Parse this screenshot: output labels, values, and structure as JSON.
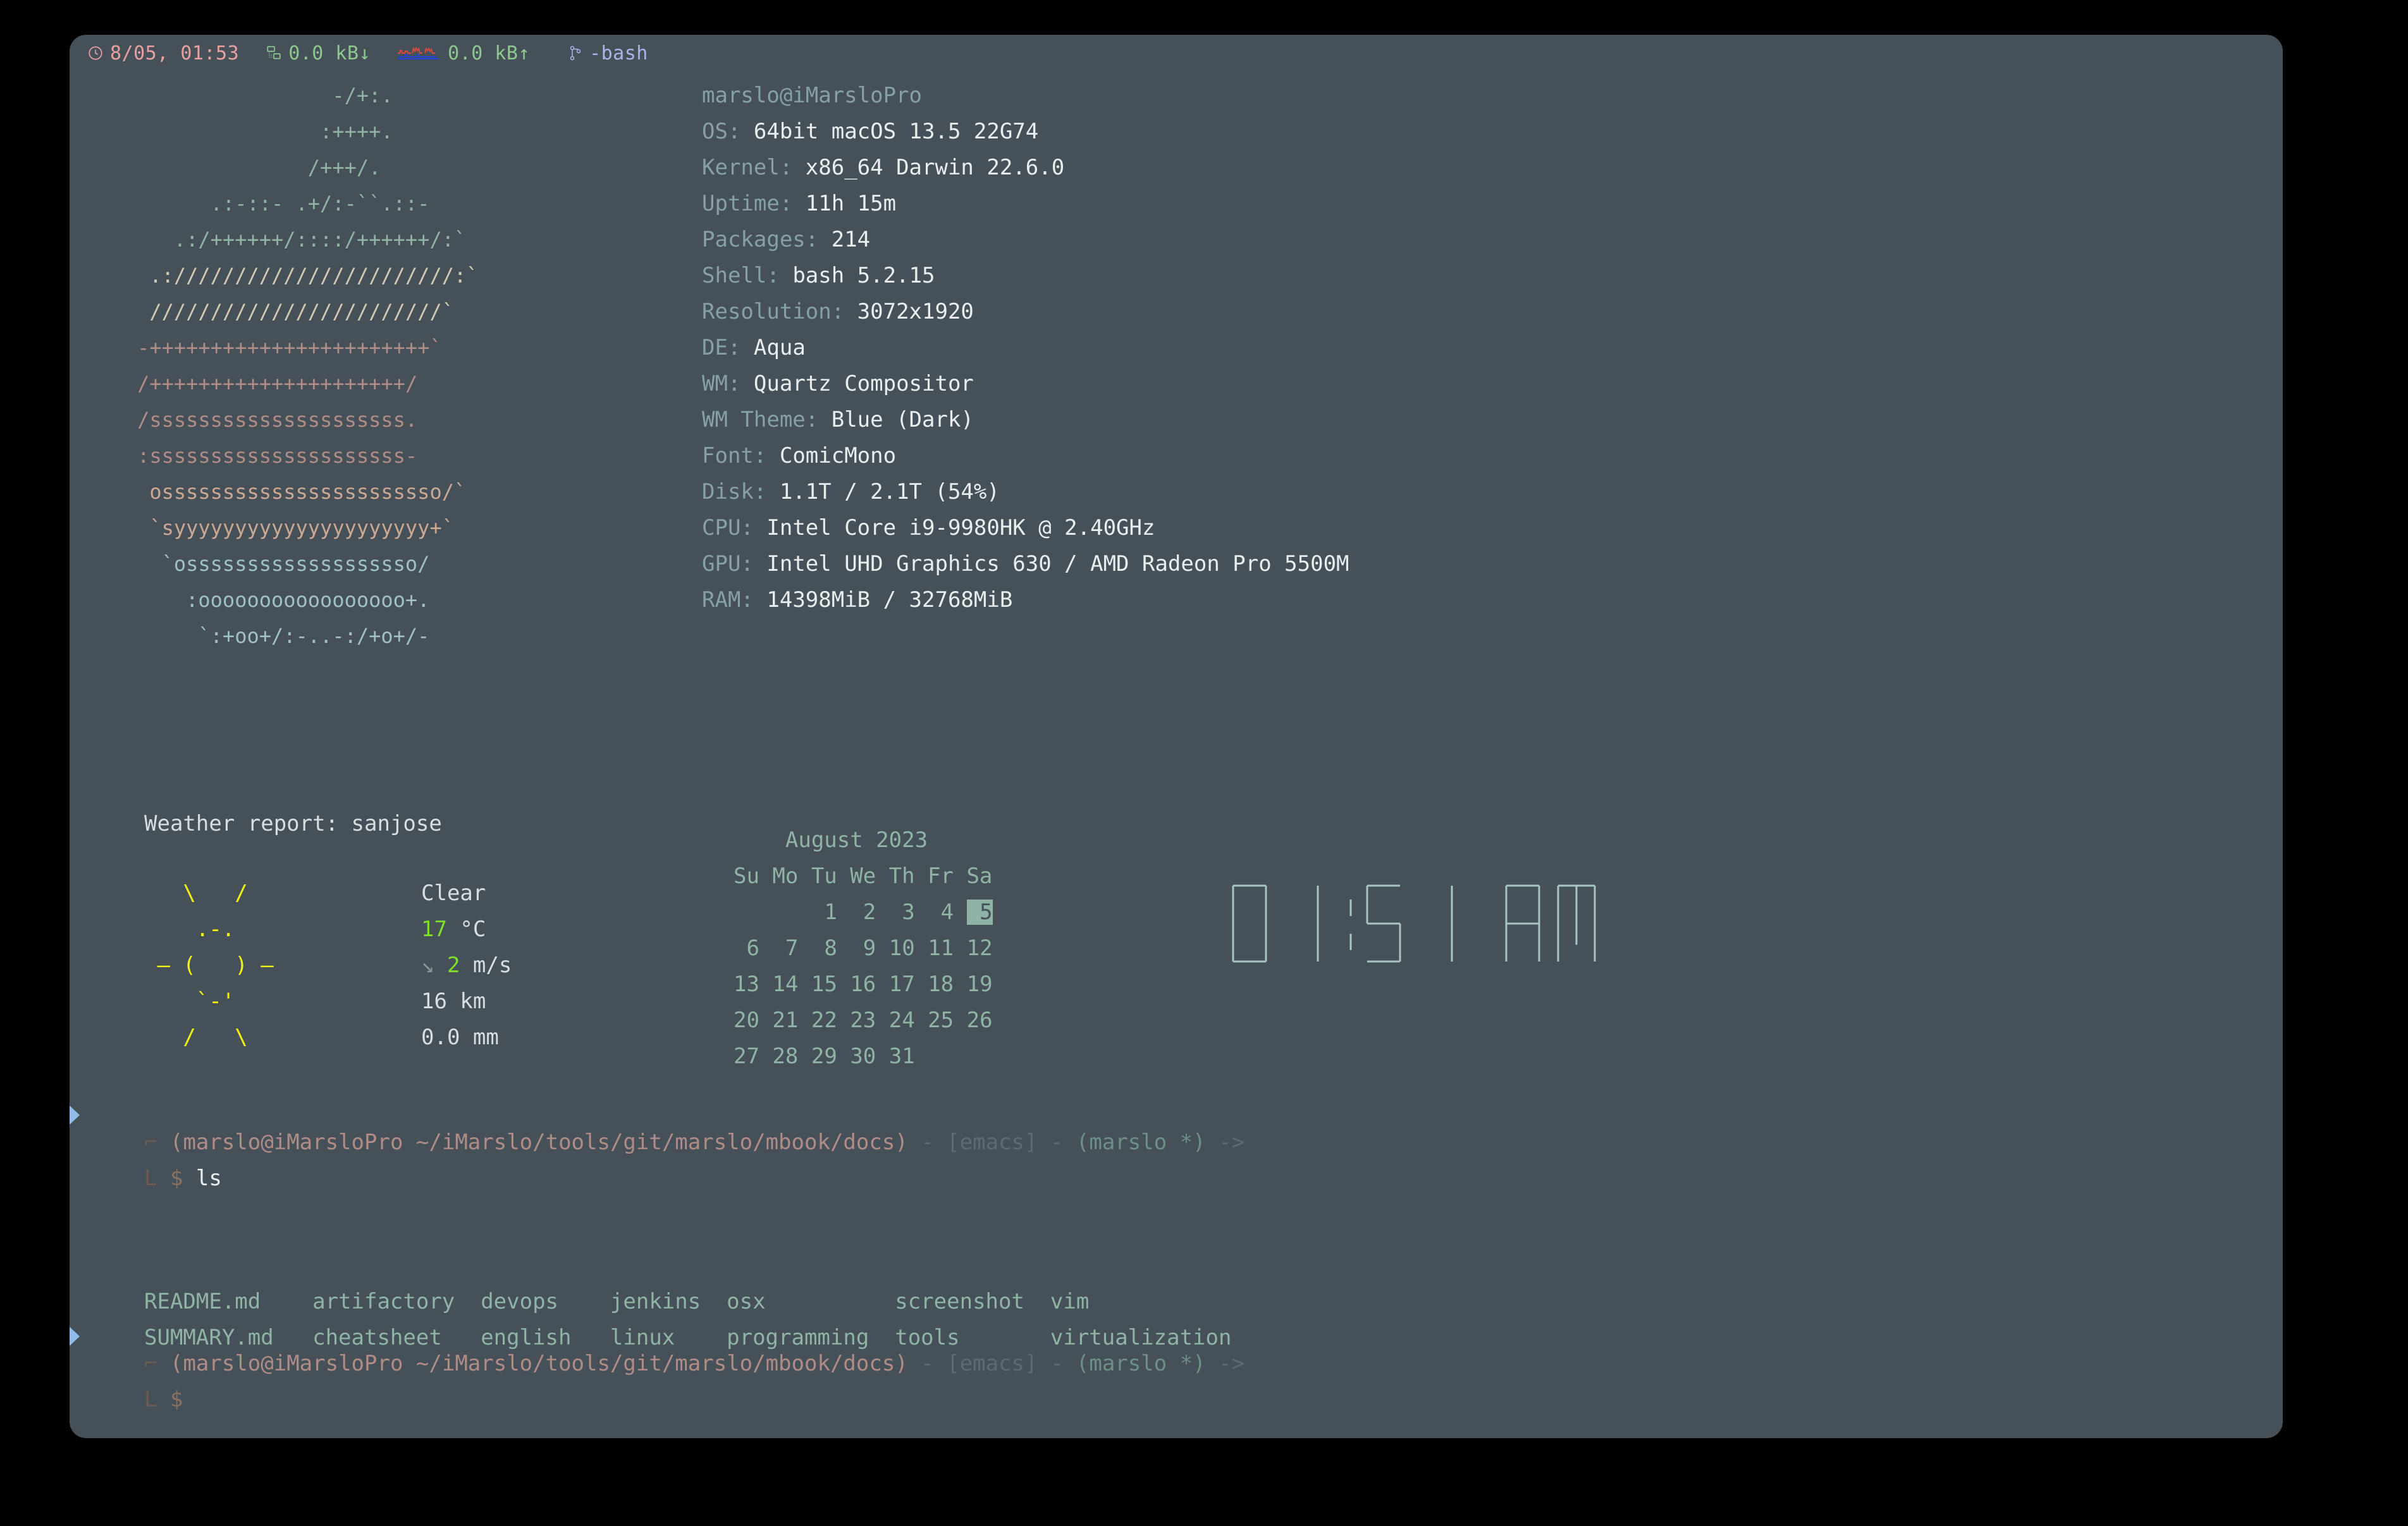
{
  "window": {
    "background": "#455058",
    "desktop_background": "#000000"
  },
  "title_bar": {
    "clock_icon": "clock-icon",
    "datetime": "8/05, 01:53",
    "net_down_icon": "network-download-icon",
    "net_down": "0.0 kB↓",
    "net_graph_icon": "network-activity-graph-icon",
    "net_up": "0.0 kB↑",
    "session_icon": "git-branch-icon",
    "session_label": "-bash",
    "colors": {
      "date": "#e8a0a0",
      "net": "#8ec88e",
      "bash": "#a9b4e8"
    }
  },
  "neofetch": {
    "ascii_logo_rows": [
      {
        "color_class": "ag1",
        "text": "                    -/+:."
      },
      {
        "color_class": "ag1",
        "text": "                   :++++."
      },
      {
        "color_class": "ag1",
        "text": "                  /+++/."
      },
      {
        "color_class": "ag1",
        "text": "          .:-::- .+/:-``.::-"
      },
      {
        "color_class": "ag1",
        "text": "       .:/++++++/::::/++++++/:`"
      },
      {
        "color_class": "ag2",
        "text": "     .:///////////////////////:`"
      },
      {
        "color_class": "ag2",
        "text": "     ////////////////////////`"
      },
      {
        "color_class": "ag3",
        "text": "    -+++++++++++++++++++++++`"
      },
      {
        "color_class": "ag3",
        "text": "    /+++++++++++++++++++++/"
      },
      {
        "color_class": "ag3",
        "text": "    /sssssssssssssssssssss."
      },
      {
        "color_class": "ag3",
        "text": "    :sssssssssssssssssssss-"
      },
      {
        "color_class": "ag4",
        "text": "     osssssssssssssssssssssso/`"
      },
      {
        "color_class": "ag4",
        "text": "     `syyyyyyyyyyyyyyyyyyyyy+`"
      },
      {
        "color_class": "ag5",
        "text": "      `osssssssssssssssssso/"
      },
      {
        "color_class": "ag5",
        "text": "        :ooooooooooooooooo+."
      },
      {
        "color_class": "ag5",
        "text": "         `:+oo+/:-..-:/+o+/-"
      }
    ],
    "user_host": "marslo@iMarsloPro",
    "entries": [
      {
        "key": "OS:",
        "value": "64bit macOS 13.5 22G74"
      },
      {
        "key": "Kernel:",
        "value": "x86_64 Darwin 22.6.0"
      },
      {
        "key": "Uptime:",
        "value": "11h 15m"
      },
      {
        "key": "Packages:",
        "value": "214"
      },
      {
        "key": "Shell:",
        "value": "bash 5.2.15"
      },
      {
        "key": "Resolution:",
        "value": "3072x1920"
      },
      {
        "key": "DE:",
        "value": "Aqua"
      },
      {
        "key": "WM:",
        "value": "Quartz Compositor"
      },
      {
        "key": "WM Theme:",
        "value": "Blue (Dark)"
      },
      {
        "key": "Font:",
        "value": "ComicMono"
      },
      {
        "key": "Disk:",
        "value": "1.1T / 2.1T (54%)"
      },
      {
        "key": "CPU:",
        "value": "Intel Core i9-9980HK @ 2.40GHz"
      },
      {
        "key": "GPU:",
        "value": "Intel UHD Graphics 630 / AMD Radeon Pro 5500M"
      },
      {
        "key": "RAM:",
        "value": "14398MiB / 32768MiB"
      }
    ]
  },
  "weather": {
    "title": "Weather report: sanjose",
    "location": "sanjose",
    "art_rows": [
      "   \\   /",
      "    .-.",
      " ― (   ) ―",
      "    `-'",
      "   /   \\"
    ],
    "condition": "Clear",
    "temperature": "17",
    "temperature_unit": "°C",
    "wind_arrow": "↘",
    "wind_speed": "2",
    "wind_unit": "m/s",
    "visibility": "16 km",
    "precipitation": "0.0 mm"
  },
  "calendar": {
    "month_year": "August 2023",
    "weekday_headers": [
      "Su",
      "Mo",
      "Tu",
      "We",
      "Th",
      "Fr",
      "Sa"
    ],
    "weeks": [
      [
        "",
        "",
        "1",
        "2",
        "3",
        "4",
        "5"
      ],
      [
        "6",
        "7",
        "8",
        "9",
        "10",
        "11",
        "12"
      ],
      [
        "13",
        "14",
        "15",
        "16",
        "17",
        "18",
        "19"
      ],
      [
        "20",
        "21",
        "22",
        "23",
        "24",
        "25",
        "26"
      ],
      [
        "27",
        "28",
        "29",
        "30",
        "31",
        "",
        ""
      ]
    ],
    "today": "5"
  },
  "clock": {
    "time": "01:51",
    "meridiem": "AM",
    "color": "#a9c5c2"
  },
  "shell": {
    "prompt1": {
      "open_bracket": "⌐",
      "open_paren": "(",
      "user_host": "marslo@iMarsloPro",
      "path": "~/iMarslo/tools/git/marslo/mbook/docs",
      "close_paren": ")",
      "dash": " - ",
      "editor": "[emacs]",
      "dash2": " - ",
      "git": "(marslo *)",
      "arrow": " ->",
      "dollar": "$",
      "command": "ls"
    },
    "prompt2": {
      "dollar": "$",
      "command": ""
    },
    "ls_output_rows": [
      "README.md    artifactory  devops    jenkins  osx          screenshot  vim",
      "SUMMARY.md   cheatsheet   english   linux    programming  tools       virtualization"
    ],
    "ls_entries": [
      "README.md",
      "artifactory",
      "devops",
      "jenkins",
      "osx",
      "screenshot",
      "vim",
      "SUMMARY.md",
      "cheatsheet",
      "english",
      "linux",
      "programming",
      "tools",
      "virtualization"
    ]
  }
}
